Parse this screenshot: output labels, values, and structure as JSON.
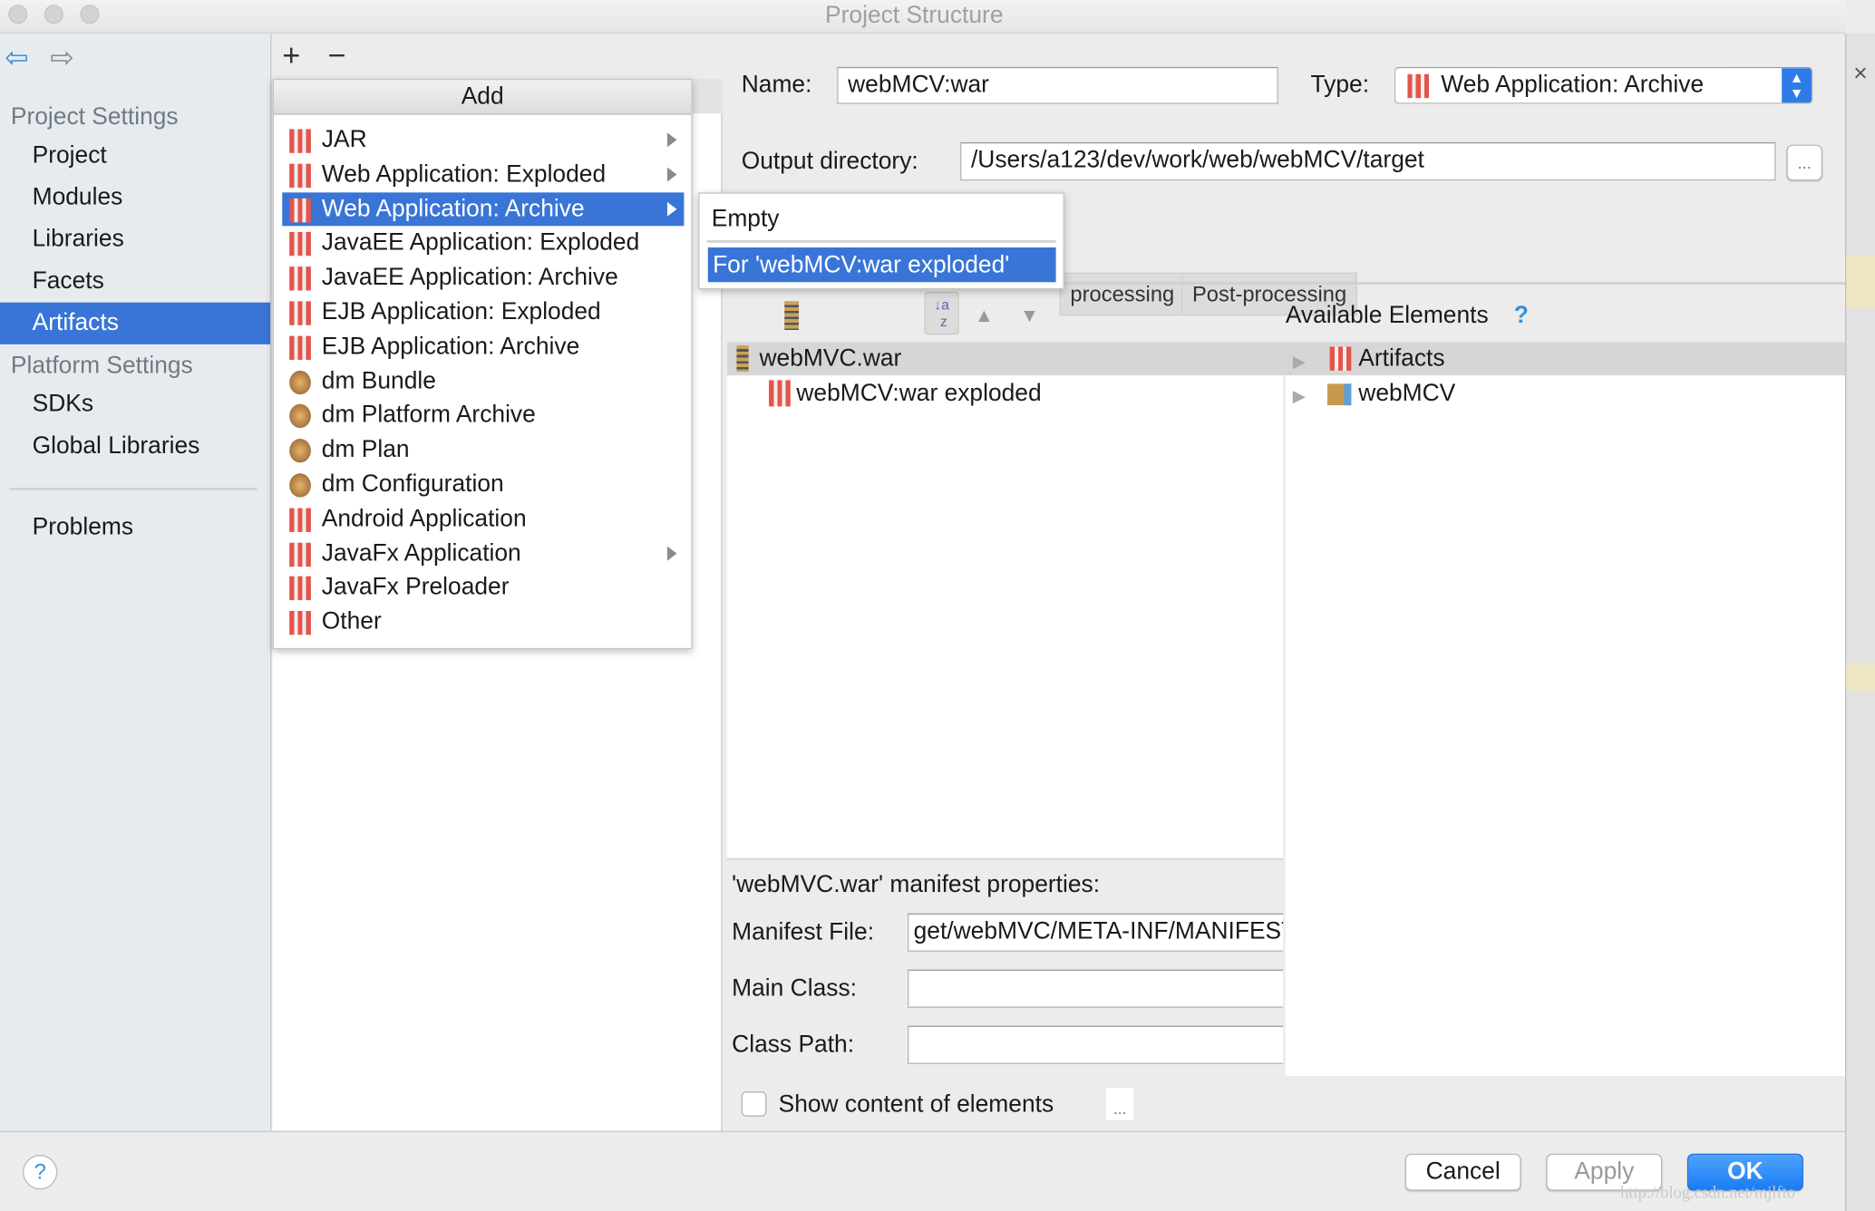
{
  "window": {
    "title": "Project Structure"
  },
  "sidebar": {
    "project_settings": "Project Settings",
    "project_items": [
      "Project",
      "Modules",
      "Libraries",
      "Facets",
      "Artifacts"
    ],
    "selected": "Artifacts",
    "platform_settings": "Platform Settings",
    "platform_items": [
      "SDKs",
      "Global Libraries"
    ],
    "problems": "Problems"
  },
  "toolbar": {
    "add": "+",
    "remove": "−"
  },
  "add_menu": {
    "title": "Add",
    "items": [
      {
        "label": "JAR",
        "submenu": true
      },
      {
        "label": "Web Application: Exploded",
        "submenu": true
      },
      {
        "label": "Web Application: Archive",
        "submenu": true,
        "selected": true
      },
      {
        "label": "JavaEE Application: Exploded"
      },
      {
        "label": "JavaEE Application: Archive"
      },
      {
        "label": "EJB Application: Exploded"
      },
      {
        "label": "EJB Application: Archive"
      },
      {
        "label": "dm Bundle"
      },
      {
        "label": "dm Platform Archive"
      },
      {
        "label": "dm Plan"
      },
      {
        "label": "dm Configuration"
      },
      {
        "label": "Android Application"
      },
      {
        "label": "JavaFx Application",
        "submenu": true
      },
      {
        "label": "JavaFx Preloader"
      },
      {
        "label": "Other"
      }
    ],
    "submenu": {
      "items": [
        "Empty",
        "For 'webMCV:war exploded'"
      ],
      "selected": "For 'webMCV:war exploded'"
    }
  },
  "artifact": {
    "name_label": "Name:",
    "name_value": "webMCV:war",
    "type_label": "Type:",
    "type_value": "Web Application: Archive",
    "output_label": "Output directory:",
    "output_value": "/Users/a123/dev/work/web/webMCV/target",
    "browse": "...",
    "tabs": [
      "processing",
      "Post-processing"
    ],
    "available_elements": "Available Elements",
    "help": "?",
    "layout_tree": [
      "webMVC.war",
      "webMCV:war exploded"
    ],
    "available_tree": [
      "Artifacts",
      "webMCV"
    ],
    "manifest_title": "'webMVC.war' manifest properties:",
    "manifest_file_label": "Manifest File:",
    "manifest_file_value": "get/webMVC/META-INF/MANIFEST.MF",
    "main_class_label": "Main Class:",
    "main_class_value": "",
    "class_path_label": "Class Path:",
    "class_path_value": "",
    "show_content": "Show content of elements",
    "show_content_checked": false,
    "more": "..."
  },
  "footer": {
    "help": "?",
    "cancel": "Cancel",
    "apply": "Apply",
    "ok": "OK",
    "watermark": "http://blog.csdn.net/mjlfto"
  },
  "side_close": "×",
  "colors": {
    "accent": "#3875d7",
    "ok": "#1a82fb"
  }
}
